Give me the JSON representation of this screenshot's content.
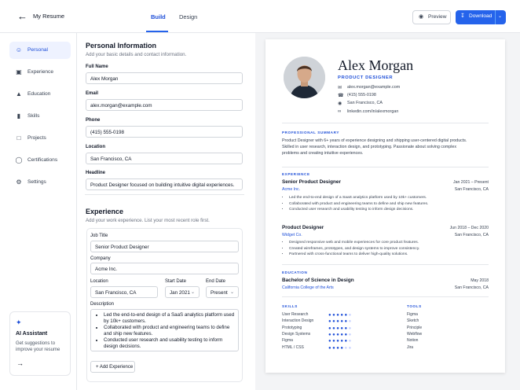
{
  "header": {
    "title": "My Resume",
    "tabs": [
      "Build",
      "Design"
    ],
    "active_tab": "Build",
    "preview_label": "Preview",
    "download_label": "Download"
  },
  "sidebar": {
    "items": [
      {
        "label": "Personal",
        "icon": "user-icon",
        "active": true
      },
      {
        "label": "Experience",
        "icon": "briefcase-icon",
        "active": false
      },
      {
        "label": "Education",
        "icon": "graduation-cap-icon",
        "active": false
      },
      {
        "label": "Skills",
        "icon": "bar-chart-icon",
        "active": false
      },
      {
        "label": "Projects",
        "icon": "folder-icon",
        "active": false
      },
      {
        "label": "Certifications",
        "icon": "award-icon",
        "active": false
      },
      {
        "label": "Settings",
        "icon": "gear-icon",
        "active": false
      }
    ],
    "ai": {
      "title": "AI Assistant",
      "description": "Get suggestions to improve your resume"
    }
  },
  "personal": {
    "title": "Personal Information",
    "subtitle": "Add your basic details and contact information.",
    "fields": {
      "full_name": {
        "label": "Full Name",
        "value": "Alex Morgan"
      },
      "email": {
        "label": "Email",
        "value": "alex.morgan@example.com"
      },
      "phone": {
        "label": "Phone",
        "value": "(415) 555-0198"
      },
      "location": {
        "label": "Location",
        "value": "San Francisco, CA"
      },
      "headline": {
        "label": "Headline",
        "value": "Product Designer focused on building intuitive digital experiences."
      }
    }
  },
  "experience_form": {
    "title": "Experience",
    "subtitle": "Add your work experience. List your most recent role first.",
    "job_title": {
      "label": "Job Title",
      "value": "Senior Product Designer"
    },
    "company": {
      "label": "Company",
      "value": "Acme Inc."
    },
    "location": {
      "label": "Location",
      "value": "San Francisco, CA"
    },
    "start_date": {
      "label": "Start Date",
      "value": "Jan 2021"
    },
    "end_date": {
      "label": "End Date",
      "value": "Present"
    },
    "description": {
      "label": "Description",
      "bullets": [
        "Led the end-to-end design of a SaaS analytics platform used by 10k+ customers.",
        "Collaborated with product and engineering teams to define and ship new features.",
        "Conducted user research and usability testing to inform design decisions."
      ]
    },
    "add_label": "+ Add Experience"
  },
  "resume": {
    "name": "Alex Morgan",
    "role": "PRODUCT DESIGNER",
    "contacts": [
      {
        "icon": "mail-icon",
        "text": "alex.morgan@example.com"
      },
      {
        "icon": "phone-icon",
        "text": "(415) 555-0198"
      },
      {
        "icon": "location-icon",
        "text": "San Francisco, CA"
      },
      {
        "icon": "link-icon",
        "text": "linkedin.com/in/alexmorgan"
      }
    ],
    "summary_heading": "PROFESSIONAL SUMMARY",
    "summary": "Product Designer with 6+ years of experience designing and shipping user-centered digital products. Skilled in user research, interaction design, and prototyping. Passionate about solving complex problems and creating intuitive experiences.",
    "experience_heading": "EXPERIENCE",
    "jobs": [
      {
        "title": "Senior Product Designer",
        "company": "Acme Inc.",
        "dates": "Jan 2021 – Present",
        "location": "San Francisco, CA",
        "bullets": [
          "Led the end-to-end design of a SaaS analytics platform used by 10k+ customers.",
          "Collaborated with product and engineering teams to define and ship new features.",
          "Conducted user research and usability testing to inform design decisions."
        ]
      },
      {
        "title": "Product Designer",
        "company": "Widget Co.",
        "dates": "Jun 2018 – Dec 2020",
        "location": "San Francisco, CA",
        "bullets": [
          "Designed responsive web and mobile experiences for core product features.",
          "Created wireframes, prototypes, and design systems to improve consistency.",
          "Partnered with cross-functional teams to deliver high-quality solutions."
        ]
      }
    ],
    "education_heading": "EDUCATION",
    "education": {
      "degree": "Bachelor of Science in Design",
      "school": "California College of the Arts",
      "date": "May 2018",
      "location": "San Francisco, CA"
    },
    "skills_heading": "SKILLS",
    "skills": [
      {
        "name": "User Research",
        "level": 5
      },
      {
        "name": "Interaction Design",
        "level": 5
      },
      {
        "name": "Prototyping",
        "level": 5
      },
      {
        "name": "Design Systems",
        "level": 5
      },
      {
        "name": "Figma",
        "level": 5
      },
      {
        "name": "HTML / CSS",
        "level": 4
      }
    ],
    "skill_max": 6,
    "tools_heading": "TOOLS",
    "tools": [
      "Figma",
      "Sketch",
      "Principle",
      "Webflow",
      "Notion",
      "Jira"
    ]
  },
  "colors": {
    "accent": "#2563eb",
    "accent_dark": "#1d4ed8",
    "active_bg": "#eef2ff"
  }
}
